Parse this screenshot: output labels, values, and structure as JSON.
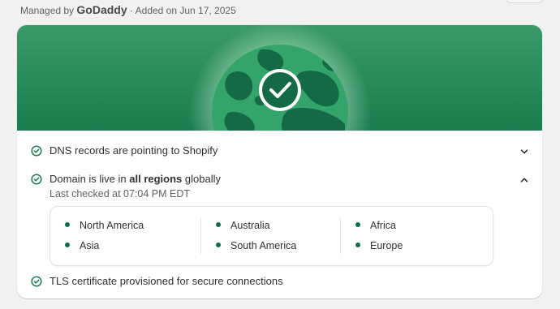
{
  "header": {
    "managed_prefix": "Managed by",
    "provider": "GoDaddy",
    "added": "· Added on Jun 17, 2025"
  },
  "colors": {
    "banner_top": "#3a9a68",
    "banner_bottom": "#1a7d4e",
    "globe": "#33a56a",
    "land": "#136a44",
    "check_green": "#1a7d4e",
    "dot_green": "#0f6e4a"
  },
  "status_items": [
    {
      "icon": "check-circle-icon",
      "text": "DNS records are pointing to Shopify",
      "chevron": "chevron-down-icon"
    },
    {
      "icon": "check-circle-icon",
      "text_before": "Domain is live in ",
      "text_bold": "all regions",
      "text_after": " globally",
      "subtext": "Last checked at 07:04 PM EDT",
      "chevron": "chevron-up-icon"
    },
    {
      "icon": "check-circle-icon",
      "text": "TLS certificate provisioned for secure connections"
    }
  ],
  "regions": [
    [
      "North America",
      "Asia"
    ],
    [
      "Australia",
      "South America"
    ],
    [
      "Africa",
      "Europe"
    ]
  ]
}
